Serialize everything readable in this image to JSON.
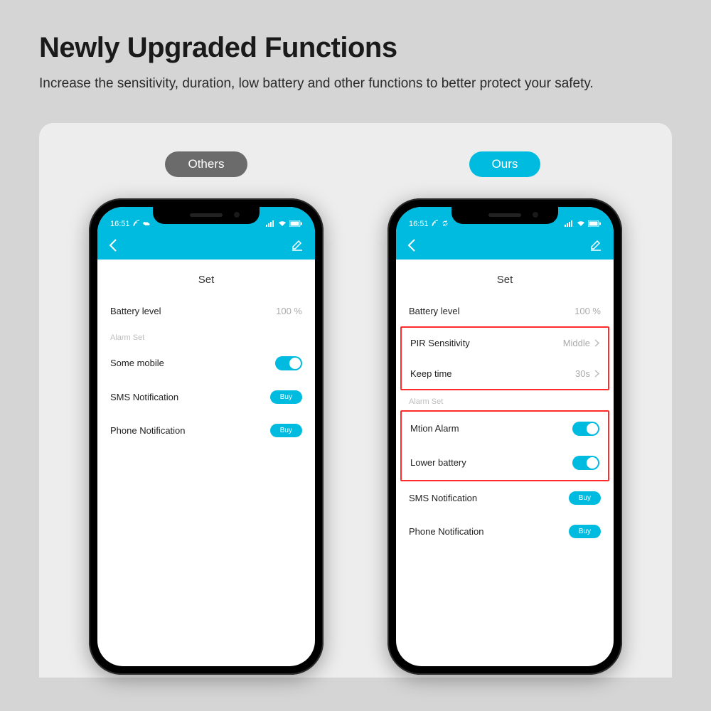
{
  "heading": "Newly Upgraded Functions",
  "subheading": "Increase the sensitivity, duration, low battery and other functions to better protect your safety.",
  "labels": {
    "others": "Others",
    "ours": "Ours"
  },
  "status": {
    "time": "16:51"
  },
  "common": {
    "section_title": "Set",
    "battery_label": "Battery level",
    "battery_value": "100 %",
    "alarm_set": "Alarm Set",
    "sms": "SMS Notification",
    "phone_notif": "Phone Notification",
    "buy": "Buy"
  },
  "others_panel": {
    "some_mobile": "Some mobile"
  },
  "ours_panel": {
    "pir_label": "PIR Sensitivity",
    "pir_value": "Middle",
    "keep_label": "Keep time",
    "keep_value": "30s",
    "motion": "Mtion Alarm",
    "lower_batt": "Lower battery"
  }
}
